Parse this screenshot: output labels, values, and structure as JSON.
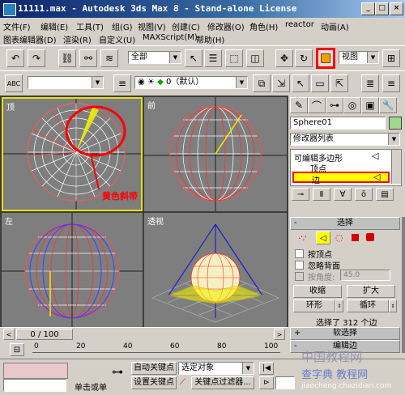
{
  "window": {
    "title": "11111.max - Autodesk 3ds Max 8 - Stand-alone License"
  },
  "menu": {
    "row1": [
      "文件(F)",
      "编辑(E)",
      "工具(T)",
      "组(G)",
      "视图(V)",
      "创建(C)",
      "修改器(O)",
      "角色(H)",
      "reactor",
      "动画(A)"
    ],
    "row2": [
      "图表编辑器(D)",
      "渲染(R)",
      "自定义(U)",
      "MAXScript(M)",
      "帮助(H)"
    ]
  },
  "toolbar": {
    "selection_filter": "全部",
    "ref_coord": "视图",
    "layer_label": "0（默认）"
  },
  "viewports": {
    "top": "顶",
    "front": "前",
    "left": "左",
    "perspective": "透视"
  },
  "annotation": {
    "text": "黄色斜带",
    "color": "#ff0000"
  },
  "command_panel": {
    "object_name": "Sphere01",
    "modifier_list": "修改器列表",
    "stack": [
      "可编辑多边形",
      "顶点",
      "边"
    ],
    "selection_rollout": "选择",
    "by_vertex": "按顶点",
    "ignore_backfacing": "忽略背面",
    "by_angle": "按角度:",
    "angle_value": "45.0",
    "shrink": "收缩",
    "grow": "扩大",
    "ring": "环形",
    "loop": "循环",
    "status": "选择了 312 个边",
    "soft_selection": "软选择",
    "edit_edges": "编辑边"
  },
  "timeline": {
    "frame": "0 / 100",
    "ticks": [
      "0",
      "20",
      "40",
      "60",
      "80",
      "100"
    ]
  },
  "bottom": {
    "auto_key": "自动关键点",
    "set_key": "设置关键点",
    "selected_object": "选定对象",
    "key_filters": "关键点过滤器...",
    "click_or_drag": "单击或单"
  },
  "watermark": {
    "line1": "中国教程网",
    "line2": "查字典 教程网",
    "line3": "jiaocheng.chazidian.com"
  },
  "colors": {
    "highlight_box": "#ff0000",
    "active_viewport_border": "#e8e000",
    "selected_stack": "#ffff00"
  }
}
